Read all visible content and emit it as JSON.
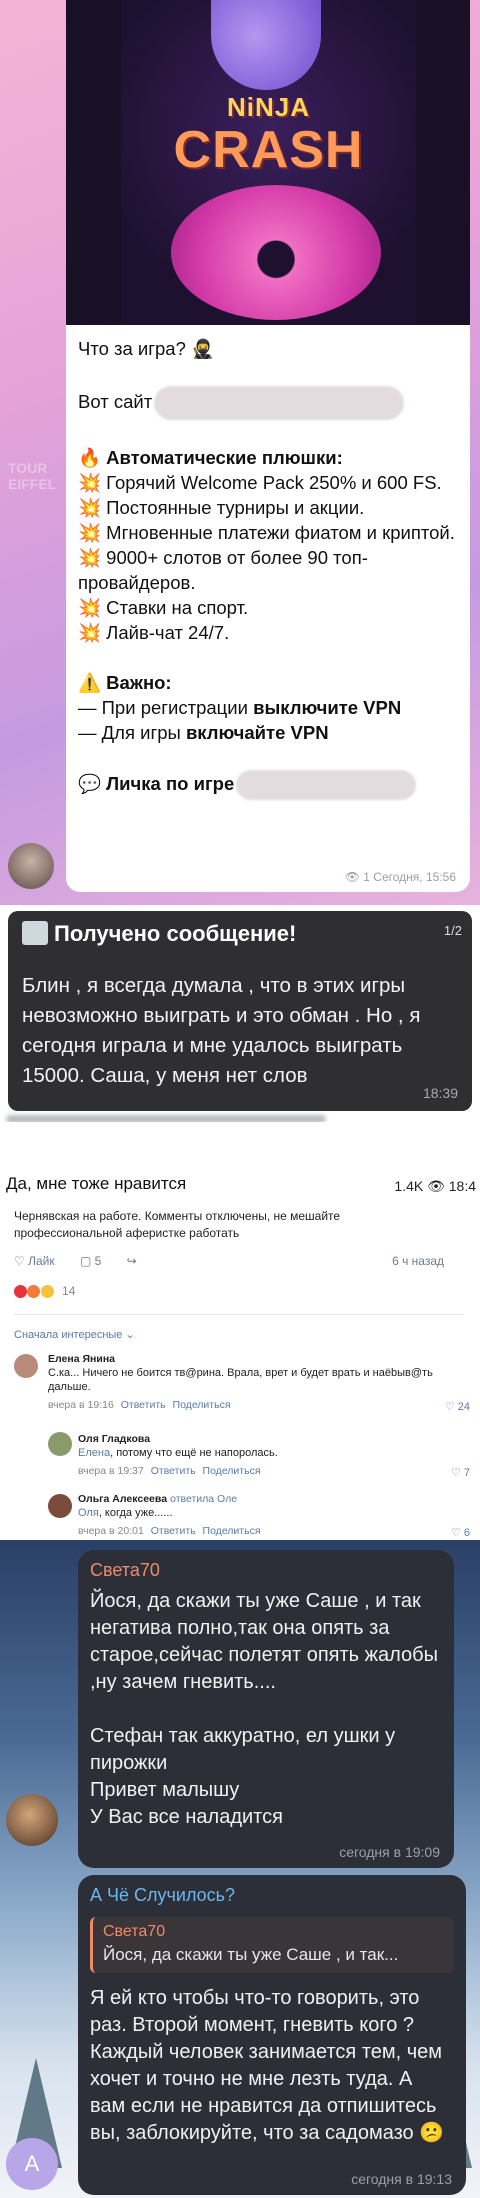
{
  "post": {
    "game_title_1": "NiNJA",
    "game_title_2": "CRASH",
    "q": "Что за игра? 🥷",
    "site": "Вот сайт",
    "auto_heading": "🔥 Автоматические плюшки:",
    "features": [
      "💥 Горячий Welcome Pack 250% и 600 FS.",
      "💥 Постоянные турниры и акции.",
      "💥 Мгновенные платежи фиатом и криптой.",
      "💥 9000+ слотов от более 90 топ-провайдеров.",
      "💥 Ставки на спорт.",
      "💥 Лайв-чат 24/7."
    ],
    "important": "⚠️ Важно:",
    "vpn1_pre": "— При регистрации ",
    "vpn1_b": "выключите VPN",
    "vpn2_pre": "— Для игры ",
    "vpn2_b": "включайте VPN",
    "personal": "💬 Личка по игре",
    "meta": "👁 1 Сегодня, 15:56"
  },
  "notification": {
    "title": "Получено сообщение!",
    "count": "1/2",
    "body": "Блин , я всегда думала , что в этих игры невозможно выиграть и это обман . Но , я сегодня играла и мне удалось выиграть 15000. Саша, у меня нет слов",
    "time": "18:39"
  },
  "comments_page": {
    "headline": "Да, мне тоже нравится",
    "views": "1.4K 👁 18:4",
    "description": "Чернявская на работе. Комменты отключены, не мешайте профессиональной аферистке работать",
    "like": "♡ Лайк",
    "comment_icon": "▢ 5",
    "share": "↪",
    "post_time": "6 ч назад",
    "reaction_count": "14",
    "sort": "Сначала интересные ⌄",
    "comments": [
      {
        "name": "Елена Янина",
        "text": "С.ка... Ничего не боится тв@рина. Врала, врет и будет врать и наёbыв@ть дальше.",
        "date": "вчера в 19:16",
        "reply": "Ответить",
        "share": "Поделиться",
        "likes": "♡ 24"
      },
      {
        "name": "Оля Гладкова",
        "to": "Елена",
        "text": ", потому что ещё не напоролась.",
        "date": "вчера в 19:37",
        "reply": "Ответить",
        "share": "Поделиться",
        "likes": "♡ 7"
      },
      {
        "name": "Ольга Алексеева",
        "badge": "ответила Оле",
        "to": "Оля",
        "text": ", когда уже......",
        "date": "вчера в 20:01",
        "reply": "Ответить",
        "share": "Поделиться",
        "likes": "♡ 6"
      }
    ]
  },
  "chat": {
    "m1_name": "Света70",
    "m1_text": "Йося, да скажи ты уже Саше , и так негатива полно,так она опять за старое,сейчас полетят опять жалобы ,ну зачем гневить....",
    "m1_text2": "Стефан так аккуратно, ел ушки у пирожки",
    "m1_text3": "Привет малышу",
    "m1_text4": "У Вас все наладится",
    "m1_time": "сегодня в 19:09",
    "m2_name": "А Чё Случилось?",
    "m2_quote_name": "Света70",
    "m2_quote_text": "Йося, да скажи ты уже Саше , и так...",
    "m2_text": "Я ей кто чтобы что-то говорить, это раз. Второй момент, гневить кого ? Каждый человек занимается тем, чем хочет и точно не мне лезть туда. А вам если не нравится да отпишитесь вы, заблокируйте, что за садомазо 😕",
    "m2_time": "сегодня в 19:13",
    "avatar_letter": "А"
  }
}
